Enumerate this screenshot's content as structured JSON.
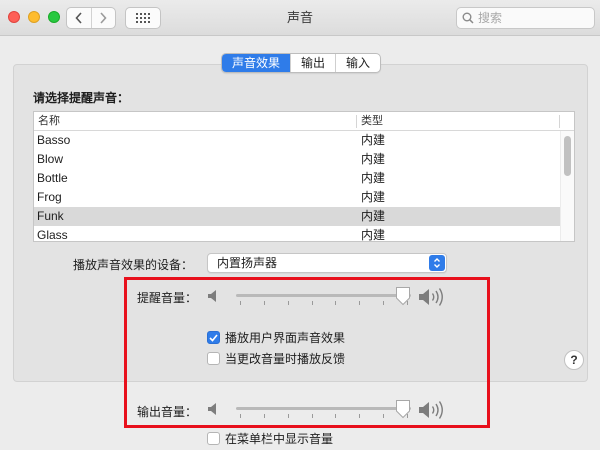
{
  "window": {
    "title": "声音"
  },
  "toolbar": {
    "search_placeholder": "搜索"
  },
  "tabs": [
    {
      "label": "声音效果",
      "active": true
    },
    {
      "label": "输出",
      "active": false
    },
    {
      "label": "输入",
      "active": false
    }
  ],
  "alert_sound": {
    "section_label": "请选择提醒声音：",
    "columns": {
      "name": "名称",
      "type": "类型"
    },
    "rows": [
      {
        "name": "Basso",
        "type": "内建",
        "selected": false
      },
      {
        "name": "Blow",
        "type": "内建",
        "selected": false
      },
      {
        "name": "Bottle",
        "type": "内建",
        "selected": false
      },
      {
        "name": "Frog",
        "type": "内建",
        "selected": false
      },
      {
        "name": "Funk",
        "type": "内建",
        "selected": true
      },
      {
        "name": "Glass",
        "type": "内建",
        "selected": false
      }
    ]
  },
  "device": {
    "label": "播放声音效果的设备：",
    "selected": "内置扬声器"
  },
  "alert_volume": {
    "label": "提醒音量：",
    "level_fraction": 1.0
  },
  "checkboxes": {
    "ui_sound_effects": {
      "label": "播放用户界面声音效果",
      "checked": true
    },
    "volume_feedback": {
      "label": "当更改音量时播放反馈",
      "checked": false
    },
    "show_in_menubar": {
      "label": "在菜单栏中显示音量",
      "checked": false
    }
  },
  "output_volume": {
    "label": "输出音量：",
    "level_fraction": 1.0
  },
  "help": {
    "label": "?"
  },
  "colors": {
    "accent": "#2f7ce9",
    "highlight": "#e8101c"
  },
  "icons": [
    "back-chevron-icon",
    "forward-chevron-icon",
    "grid-icon",
    "search-icon",
    "speaker-low-icon",
    "speaker-high-icon",
    "checkmark-icon",
    "updown-arrows-icon"
  ]
}
